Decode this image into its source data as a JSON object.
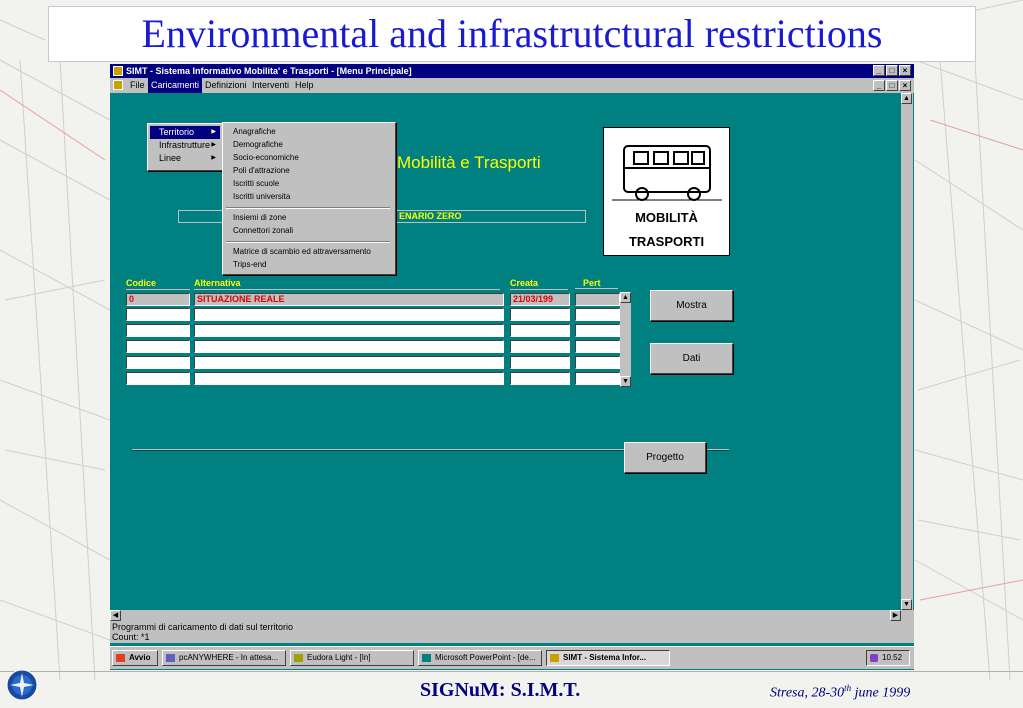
{
  "slide": {
    "title": "Environmental and infrastrutctural restrictions",
    "footer_center": "SIGNuM: S.I.M.T.",
    "footer_right_prefix": "Stresa, 28-30",
    "footer_right_sup": "th",
    "footer_right_suffix": " june 1999"
  },
  "window": {
    "title": "SIMT - Sistema Informativo Mobilita' e Trasporti - [Menu Principale]",
    "min": "_",
    "max": "□",
    "close": "×"
  },
  "menubar": {
    "file": "File",
    "caricamenti": "Caricamenti",
    "definizioni": "Definizioni",
    "interventi": "Interventi",
    "help": "Help"
  },
  "dropdown": {
    "items": [
      "Territorio",
      "Infrastrutture",
      "Linee"
    ]
  },
  "submenu": {
    "items": [
      "Anagrafiche",
      "Demografiche",
      "Socio-economiche",
      "Poli d'attrazione",
      "Iscritti scuole",
      "Iscritti universita",
      "Insiemi di zone",
      "Connettori zonali",
      "Matrice di scambio ed attraversamento",
      "Trips-end"
    ]
  },
  "app": {
    "title_partial": "Mobilità e Trasporti",
    "scenario_partial": "ENARIO ZERO",
    "logo_line1": "MOBILITÀ",
    "logo_line2": "TRASPORTI"
  },
  "table": {
    "headers": {
      "codice": "Codice",
      "alternativa": "Alternativa",
      "creata": "Creata",
      "pert": "Pert"
    },
    "rows": [
      {
        "codice": "0",
        "alternativa": "SITUAZIONE REALE",
        "creata": "21/03/199",
        "pert": ""
      },
      {
        "codice": "",
        "alternativa": "",
        "creata": "",
        "pert": ""
      },
      {
        "codice": "",
        "alternativa": "",
        "creata": "",
        "pert": ""
      },
      {
        "codice": "",
        "alternativa": "",
        "creata": "",
        "pert": ""
      },
      {
        "codice": "",
        "alternativa": "",
        "creata": "",
        "pert": ""
      },
      {
        "codice": "",
        "alternativa": "",
        "creata": "",
        "pert": ""
      }
    ]
  },
  "buttons": {
    "mostra": "Mostra",
    "dati": "Dati",
    "progetto": "Progetto"
  },
  "status": {
    "line1": "Programmi di caricamento di dati sul territorio",
    "line2": "Count: *1"
  },
  "taskbar": {
    "start": "Avvio",
    "tasks": [
      "pcANYWHERE - In attesa...",
      "Eudora Light - [In]",
      "Microsoft PowerPoint - [de...",
      "SIMT - Sistema Infor..."
    ],
    "clock": "10.52"
  },
  "colors": {
    "title_blue": "#1a1ad0",
    "app_teal": "#008080",
    "header_yellow": "#ffff00",
    "selected_red": "#e00000"
  }
}
